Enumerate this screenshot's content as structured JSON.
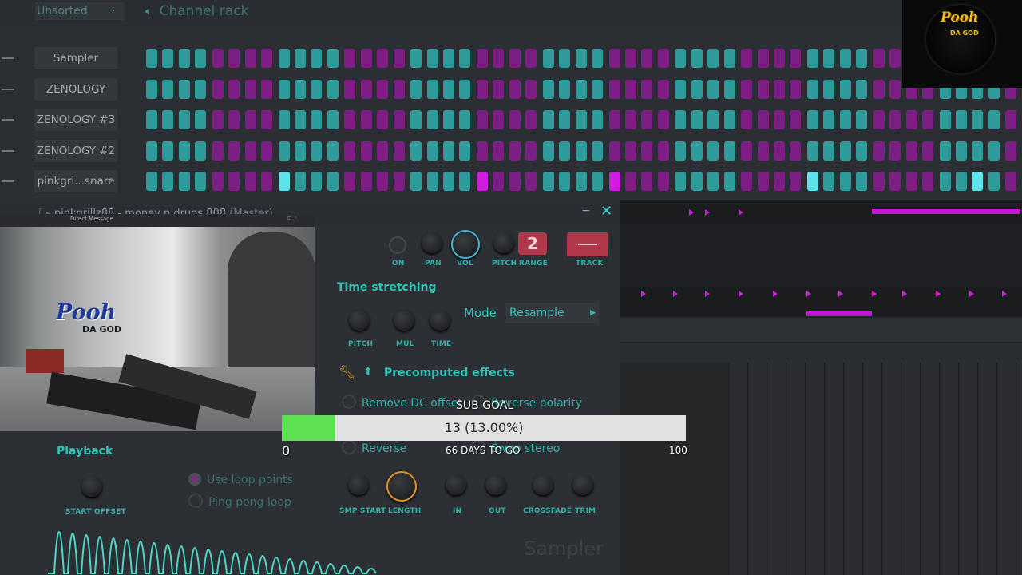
{
  "browser": {
    "folder": "Unsorted",
    "folder_arrow": "›"
  },
  "channel_rack": {
    "title": "Channel rack",
    "channels": [
      {
        "name": "Sampler",
        "steps": "ttttmmmmttttmmmmttttmmmmttttmmmmttttmmmmttttmmmmttttmmmmttttmmmmtttt",
        "hits": []
      },
      {
        "name": "ZENOLOGY",
        "steps": "ttttmmmmttttmmmmttttmmmmttttmmmmttttmmmmttttmmmmttttmmmmttttmmmmtttt",
        "hits": []
      },
      {
        "name": "ZENOLOGY #3",
        "steps": "ttttmmmmttttmmmmttttmmmmttttmmmmttttmmmmttttmmmmttttmmmmttttmmmmtttt",
        "hits": []
      },
      {
        "name": "ZENOLOGY #2",
        "steps": "ttttmmmmttttmmmmttttmmmmttttmmmmttttmmmmttttmmmmttttmmmmttttmmmmtttt",
        "hits": []
      },
      {
        "name": "pinkgri...snare",
        "steps": "ttttmmmmttttmmmmttttmmmmttttmmmmttttmmmmttttmmmmttttmmmmttttmmmmtttt",
        "hits": [
          8,
          20,
          28,
          40,
          50
        ]
      }
    ]
  },
  "logo": {
    "text": "Pooh",
    "sub": "DA GOD"
  },
  "sampler": {
    "title_prefix": "pinkgrillz88 - money n drugs 808",
    "title_suffix": "(Master)",
    "minimize": "−",
    "close": "✕",
    "top_labels": {
      "on": "ON",
      "pan": "PAN",
      "vol": "VOL",
      "pitch": "PITCH",
      "range": "RANGE",
      "track": "TRACK"
    },
    "range_value": "2",
    "time_stretching": {
      "title": "Time stretching",
      "mode_label": "Mode",
      "mode_value": "Resample",
      "knobs": {
        "pitch": "PITCH",
        "mul": "MUL",
        "time": "TIME"
      }
    },
    "precomputed": {
      "title": "Precomputed effects",
      "remove_dc": "Remove DC offset",
      "reverse_polarity": "Reverse polarity",
      "reverse": "Reverse",
      "swap_stereo": "Swap stereo"
    },
    "playback": {
      "title": "Playback",
      "start_offset": "START OFFSET",
      "use_loop_points": "Use loop points",
      "ping_pong_loop": "Ping pong loop"
    },
    "bottom_knobs": {
      "smp_start": "SMP START",
      "length": "LENGTH",
      "in": "IN",
      "out": "OUT",
      "crossfade": "CROSSFADE",
      "trim": "TRIM"
    },
    "watermark": "Sampler"
  },
  "webcam": {
    "title": "Direct Message",
    "logo_text": "Pooh",
    "logo_sub": "DA GOD"
  },
  "sub_goal": {
    "title": "SUB GOAL",
    "current": 13,
    "target": 100,
    "fraction": 0.13,
    "label": "13 (13.00%)",
    "min_label": "0",
    "max_label": "100",
    "days_label": "66 DAYS TO GO"
  },
  "colors": {
    "teal_step": "#2f9b9b",
    "magenta_step": "#7c1e84",
    "accent": "#2fc4b8",
    "goal_fill": "#5ee053"
  }
}
